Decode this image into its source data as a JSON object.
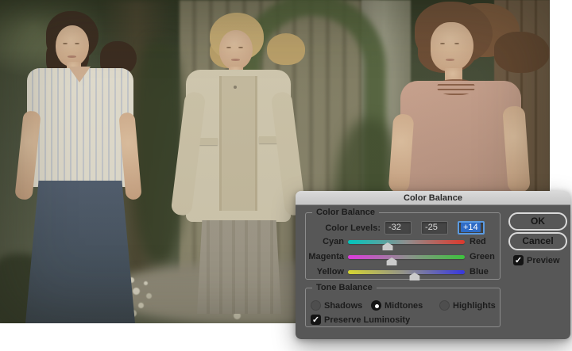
{
  "window": {
    "title": "Color Balance"
  },
  "color_balance": {
    "legend": "Color Balance",
    "color_levels_label": "Color Levels:",
    "levels": [
      "-32",
      "-25",
      "+14"
    ],
    "mid_color": "#8f8f8f",
    "sliders": [
      {
        "left_label": "Cyan",
        "right_label": "Red",
        "value": -32,
        "percent": 34,
        "left_color": "#00c6bd",
        "right_color": "#dd382c"
      },
      {
        "left_label": "Magenta",
        "right_label": "Green",
        "value": -25,
        "percent": 37.5,
        "left_color": "#de3ade",
        "right_color": "#3cc23c"
      },
      {
        "left_label": "Yellow",
        "right_label": "Blue",
        "value": 14,
        "percent": 57,
        "left_color": "#d6d631",
        "right_color": "#3737de"
      }
    ]
  },
  "tone_balance": {
    "legend": "Tone Balance",
    "options": [
      {
        "label": "Shadows",
        "selected": false
      },
      {
        "label": "Midtones",
        "selected": true
      },
      {
        "label": "Highlights",
        "selected": false
      }
    ],
    "preserve_luminosity": {
      "label": "Preserve Luminosity",
      "checked": true
    }
  },
  "actions": {
    "ok": "OK",
    "cancel": "Cancel",
    "preview": {
      "label": "Preview",
      "checked": true
    }
  }
}
